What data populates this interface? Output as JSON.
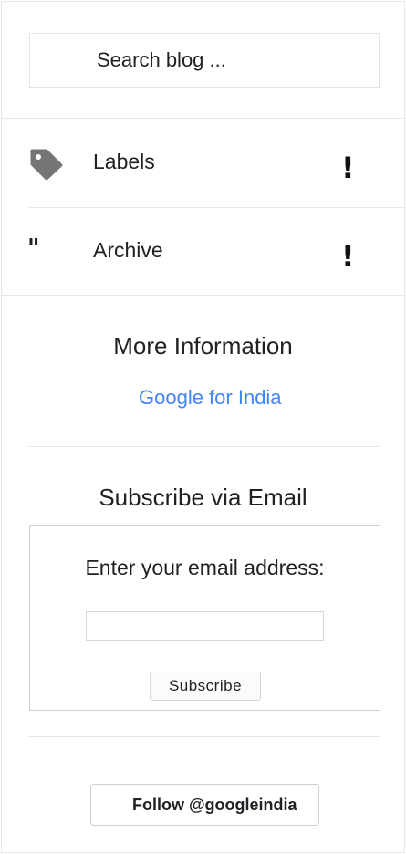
{
  "search": {
    "placeholder": "Search blog ..."
  },
  "nav": {
    "items": [
      {
        "label": "Labels",
        "icon": "tag-icon",
        "chevron": "!"
      },
      {
        "label": "Archive",
        "icon": "quote-icon",
        "icon_glyph": "\"",
        "chevron": "!"
      }
    ]
  },
  "more_info": {
    "title": "More Information",
    "link_label": "Google for India",
    "link_color": "#4285f4"
  },
  "subscribe": {
    "title": "Subscribe via Email",
    "prompt": "Enter your email address:",
    "email_value": "",
    "button_label": "Subscribe"
  },
  "follow": {
    "button_label": "Follow @googleindia"
  }
}
